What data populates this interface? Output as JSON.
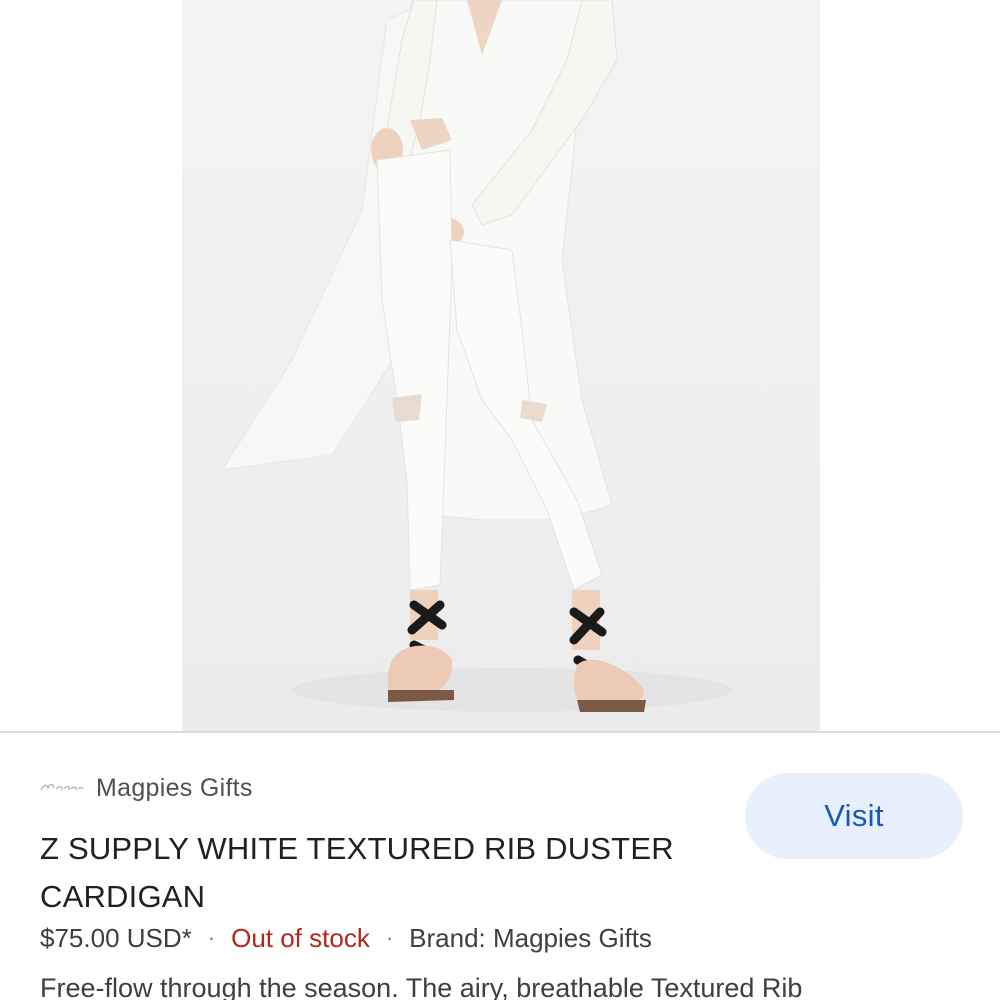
{
  "product_image": {
    "alt": "Model wearing white textured rib duster cardigan with white jeans and black sandals"
  },
  "merchant": {
    "logo_text": "Magpies gifts",
    "name": "Magpies Gifts"
  },
  "visit_button": {
    "label": "Visit"
  },
  "product": {
    "title": "Z SUPPLY WHITE TEXTURED RIB DUSTER CARDIGAN",
    "price": "$75.00 USD*",
    "separator": "·",
    "stock_status": "Out of stock",
    "brand": "Brand: Magpies Gifts",
    "description": "Free-flow through the season. The airy, breathable Textured Rib"
  },
  "colors": {
    "accent_button_bg": "#e8f0fe",
    "accent_button_text": "#1a57b8",
    "out_of_stock": "#b3261e"
  }
}
